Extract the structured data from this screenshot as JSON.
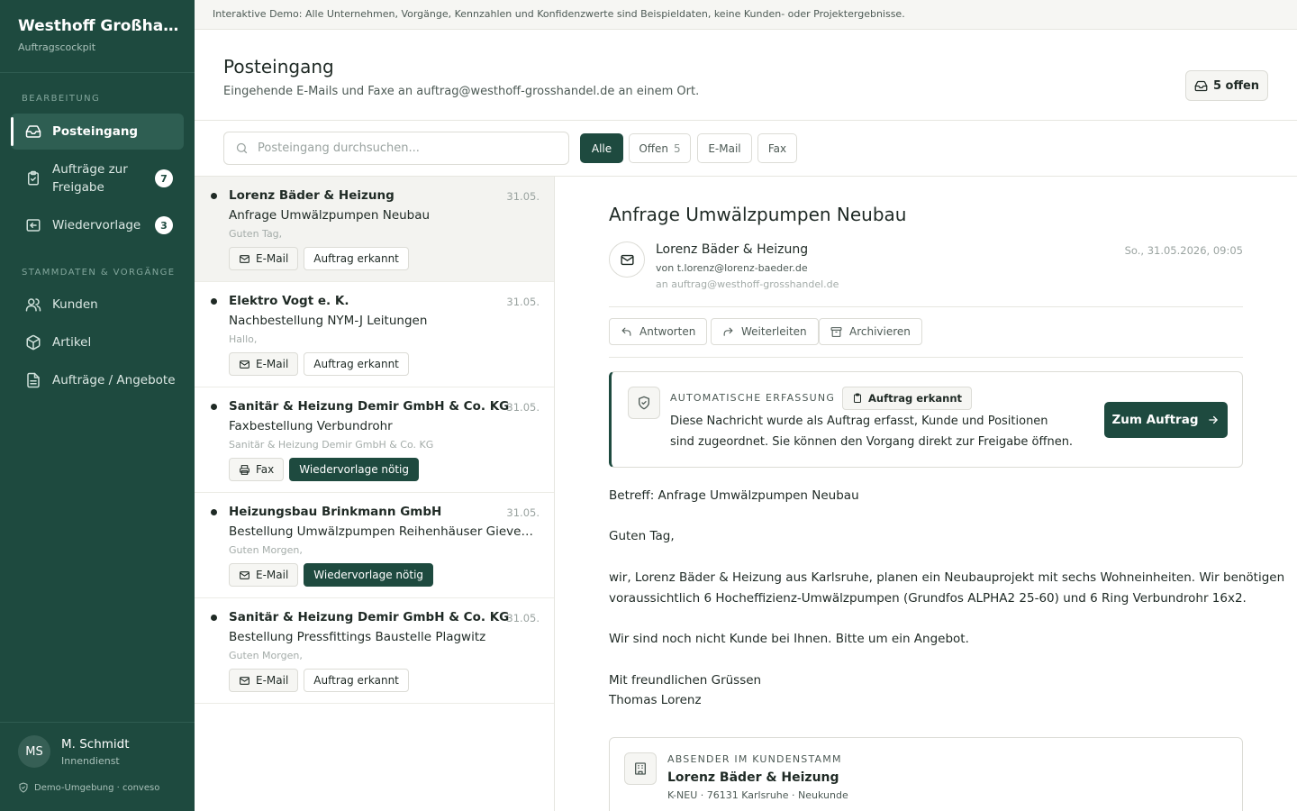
{
  "app": {
    "title": "Westhoff Großhan...",
    "subtitle": "Auftragscockpit"
  },
  "sidebar": {
    "section_edit": "BEARBEITUNG",
    "section_master": "STAMMDATEN & VORGÄNGE",
    "items": [
      {
        "label": "Posteingang",
        "icon": "inbox-icon"
      },
      {
        "label": "Aufträge zur Freigabe",
        "line1": "Aufträge zur",
        "line2": "Freigabe",
        "count": "7",
        "icon": "clipboard-check-icon"
      },
      {
        "label": "Wiedervorlage",
        "count": "3",
        "icon": "reply-box-icon"
      },
      {
        "label": "Kunden",
        "icon": "users-icon"
      },
      {
        "label": "Artikel",
        "icon": "package-icon"
      },
      {
        "label": "Aufträge / Angebote",
        "icon": "document-icon"
      }
    ],
    "user": {
      "initials": "MS",
      "name": "M. Schmidt",
      "role": "Innendienst"
    },
    "env": "Demo-Umgebung · conveso"
  },
  "banner": "Interaktive Demo: Alle Unternehmen, Vorgänge, Kennzahlen und Konfidenzwerte sind Beispieldaten, keine Kunden- oder Projektergebnisse.",
  "header": {
    "title": "Posteingang",
    "subtitle": "Eingehende E-Mails und Faxe an auftrag@westhoff-grosshandel.de an einem Ort.",
    "open_label": "5 offen"
  },
  "search": {
    "placeholder": "Posteingang durchsuchen..."
  },
  "filters": [
    {
      "label": "Alle"
    },
    {
      "label": "Offen",
      "count": "5"
    },
    {
      "label": "E-Mail"
    },
    {
      "label": "Fax"
    }
  ],
  "messages": [
    {
      "from": "Lorenz Bäder & Heizung",
      "date": "31.05.",
      "subject": "Anfrage Umwälzpumpen Neubau",
      "preview": "Guten Tag,",
      "channel": "E-Mail",
      "status": "Auftrag erkannt"
    },
    {
      "from": "Elektro Vogt e. K.",
      "date": "31.05.",
      "subject": "Nachbestellung NYM-J Leitungen",
      "preview": "Hallo,",
      "channel": "E-Mail",
      "status": "Auftrag erkannt"
    },
    {
      "from": "Sanitär & Heizung Demir GmbH & Co. KG",
      "date": "31.05.",
      "subject": "Faxbestellung Verbundrohr",
      "preview": "Sanitär & Heizung Demir GmbH & Co. KG",
      "channel": "Fax",
      "status": "Wiedervorlage nötig"
    },
    {
      "from": "Heizungsbau Brinkmann GmbH",
      "date": "31.05.",
      "subject": "Bestellung Umwälzpumpen Reihenhäuser Gievenbeck",
      "preview": "Guten Morgen,",
      "channel": "E-Mail",
      "status": "Wiedervorlage nötig"
    },
    {
      "from": "Sanitär & Heizung Demir GmbH & Co. KG",
      "date": "31.05.",
      "subject": "Bestellung Pressfittings Baustelle Plagwitz",
      "preview": "Guten Morgen,",
      "channel": "E-Mail",
      "status": "Auftrag erkannt"
    }
  ],
  "detail": {
    "title": "Anfrage Umwälzpumpen Neubau",
    "from_name": "Lorenz Bäder & Heizung",
    "from_prefix": "von",
    "from_email": "t.lorenz@lorenz-baeder.de",
    "to": "an auftrag@westhoff-grosshandel.de",
    "datetime": "So., 31.05.2026, 09:05",
    "actions": {
      "reply": "Antworten",
      "forward": "Weiterleiten",
      "archive": "Archivieren"
    },
    "capture": {
      "label": "AUTOMATISCHE ERFASSUNG",
      "badge": "Auftrag erkannt",
      "text": "Diese Nachricht wurde als Auftrag erfasst, Kunde und Positionen sind zugeordnet. Sie können den Vorgang direkt zur Freigabe öffnen.",
      "button": "Zum Auftrag"
    },
    "body": {
      "line1": "Betreff: Anfrage Umwälzpumpen Neubau",
      "line2": "Guten Tag,",
      "line3": "wir, Lorenz Bäder & Heizung aus Karlsruhe, planen ein Neubauprojekt mit sechs Wohneinheiten. Wir benötigen",
      "line4": "voraussichtlich 6 Hocheffizienz-Umwälzpumpen (Grundfos ALPHA2 25-60) und 6 Ring Verbundrohr 16x2.",
      "line5": "Wir sind noch nicht Kunde bei Ihnen. Bitte um ein Angebot.",
      "line6": "Mit freundlichen Grüssen",
      "line7": "Thomas Lorenz"
    },
    "customer": {
      "label": "ABSENDER IM KUNDENSTAMM",
      "name": "Lorenz Bäder & Heizung",
      "meta": "K-NEU · 76131 Karlsruhe · Neukunde"
    }
  }
}
